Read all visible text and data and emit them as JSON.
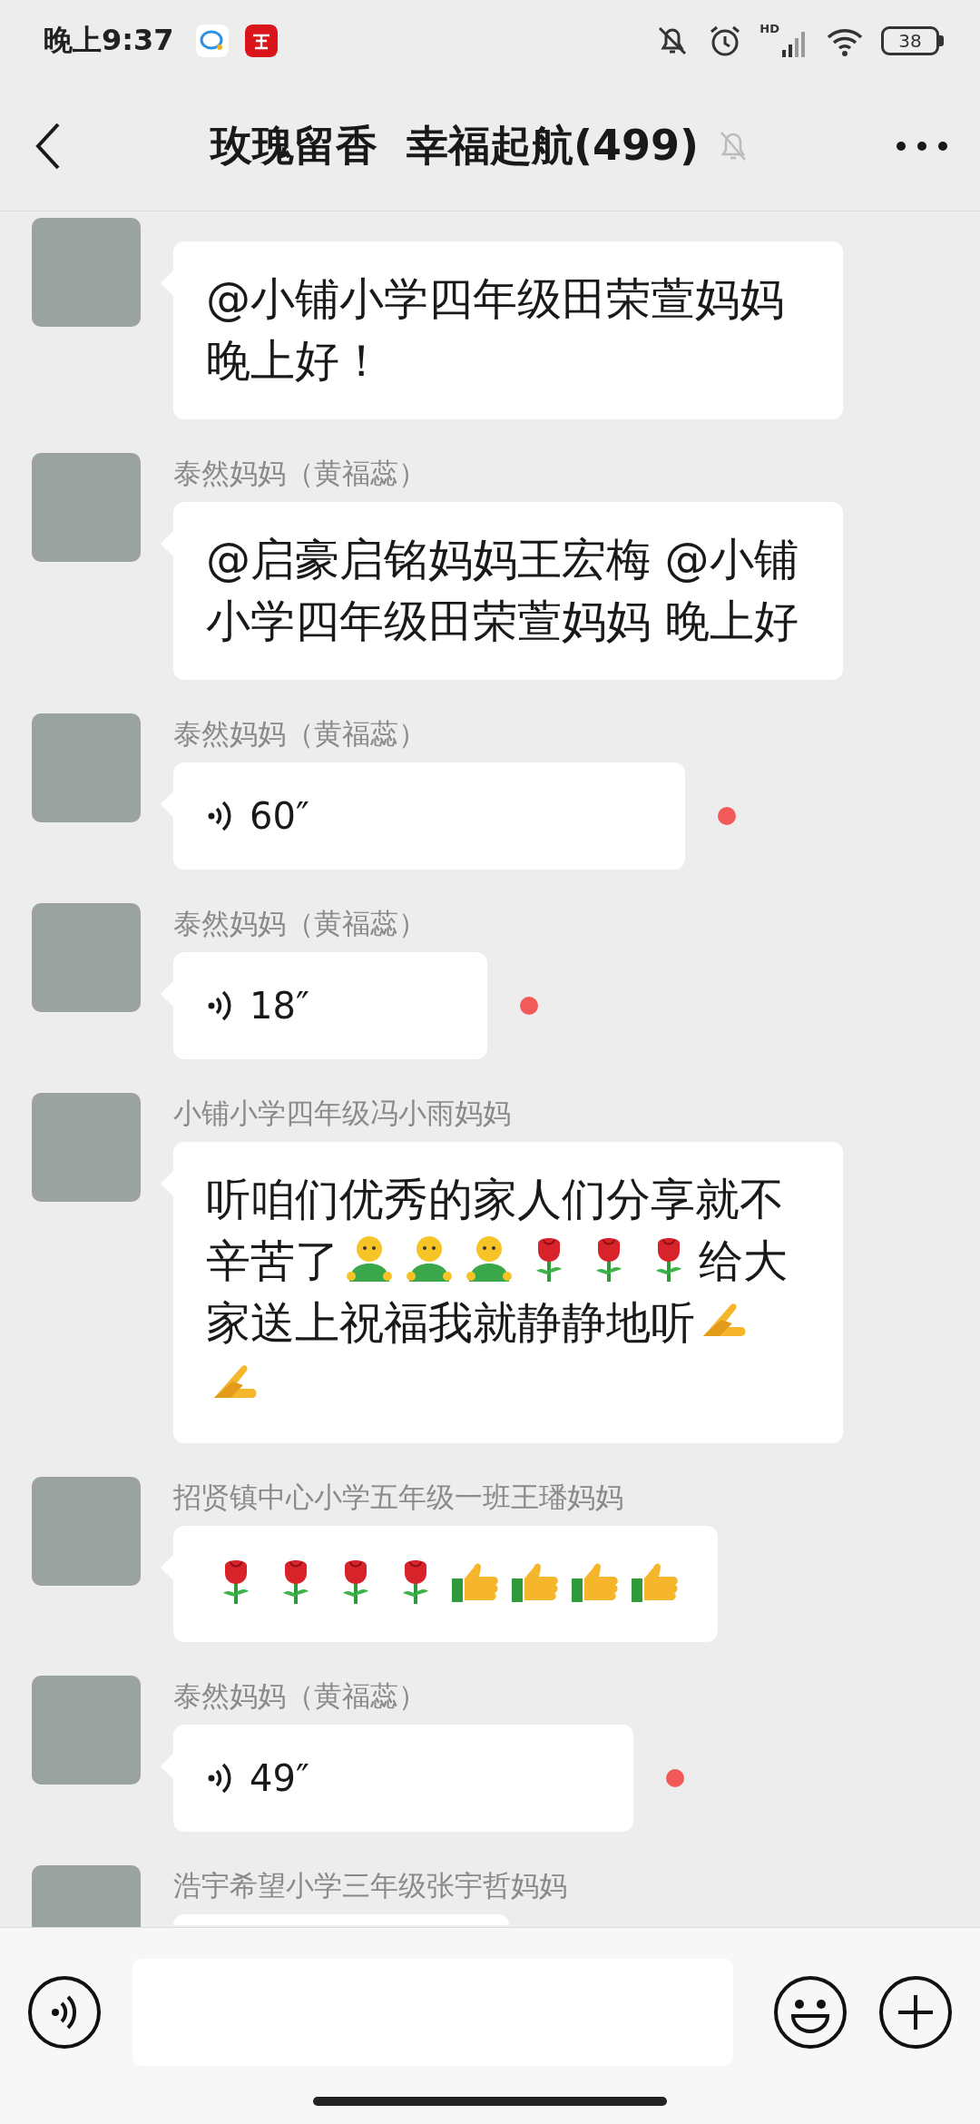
{
  "status_bar": {
    "time": "晚上9:37",
    "network": "HD",
    "battery": "38"
  },
  "header": {
    "title": "玫瑰留香  幸福起航(499)",
    "muted": true
  },
  "messages": [
    {
      "kind": "text",
      "content": [
        {
          "kind": "text",
          "text": "@小铺小学四年级田荣萱妈妈晚上好！"
        }
      ]
    },
    {
      "kind": "text",
      "sender": "泰然妈妈（黄福蕊）",
      "content": [
        {
          "kind": "text",
          "text": "@启豪启铭妈妈王宏梅 @小铺小学四年级田荣萱妈妈  晚上好"
        }
      ]
    },
    {
      "kind": "voice",
      "sender": "泰然妈妈（黄福蕊）",
      "duration": "60″",
      "unread": true
    },
    {
      "kind": "voice",
      "sender": "泰然妈妈（黄福蕊）",
      "duration": "18″",
      "unread": true
    },
    {
      "kind": "text",
      "sender": "小铺小学四年级冯小雨妈妈",
      "content": [
        {
          "kind": "text",
          "text": "听咱们优秀的家人们分享就不辛苦了"
        },
        {
          "kind": "person"
        },
        {
          "kind": "person"
        },
        {
          "kind": "person"
        },
        {
          "kind": "rose"
        },
        {
          "kind": "rose"
        },
        {
          "kind": "rose"
        },
        {
          "kind": "text",
          "text": "给大家送上祝福我就静静地听"
        },
        {
          "kind": "palms"
        },
        {
          "kind": "palms"
        }
      ]
    },
    {
      "kind": "text",
      "sender": "招贤镇中心小学五年级一班王璠妈妈",
      "content": [
        {
          "kind": "rose"
        },
        {
          "kind": "rose"
        },
        {
          "kind": "rose"
        },
        {
          "kind": "rose"
        },
        {
          "kind": "thumbsup"
        },
        {
          "kind": "thumbsup"
        },
        {
          "kind": "thumbsup"
        },
        {
          "kind": "thumbsup"
        }
      ]
    },
    {
      "kind": "voice",
      "sender": "泰然妈妈（黄福蕊）",
      "duration": "49″",
      "unread": true
    },
    {
      "kind": "text",
      "sender": "浩宇希望小学三年级张宇哲妈妈"
    }
  ]
}
